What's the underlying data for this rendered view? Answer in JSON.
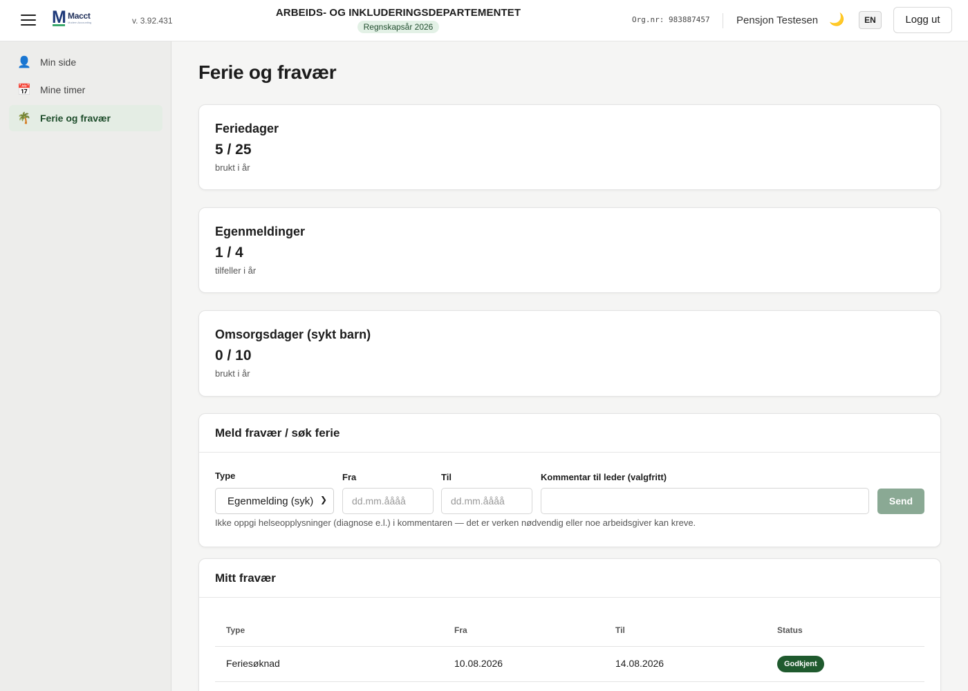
{
  "header": {
    "logo_name": "Macct",
    "logo_sub": "Modern Accounting",
    "version": "v. 3.92.431",
    "org_name": "ARBEIDS- OG INKLUDERINGSDEPARTEMENTET",
    "fiscal_year": "Regnskapsår 2026",
    "org_nr": "Org.nr: 983887457",
    "user_name": "Pensjon Testesen",
    "theme_icon": "moon-icon",
    "language_button": "EN",
    "logout_label": "Logg ut"
  },
  "sidebar": {
    "items": [
      {
        "label": "Min side",
        "icon": "user-icon",
        "active": false
      },
      {
        "label": "Mine timer",
        "icon": "calendar-icon",
        "active": false
      },
      {
        "label": "Ferie og fravær",
        "icon": "palm-tree-icon",
        "active": true
      }
    ]
  },
  "main": {
    "title": "Ferie og fravær",
    "stats": [
      {
        "title": "Feriedager",
        "value": "5 / 25",
        "sub": "brukt i år"
      },
      {
        "title": "Egenmeldinger",
        "value": "1 / 4",
        "sub": "tilfeller i år"
      },
      {
        "title": "Omsorgsdager (sykt barn)",
        "value": "0 / 10",
        "sub": "brukt i år"
      }
    ],
    "form": {
      "title": "Meld fravær / søk ferie",
      "type_label": "Type",
      "type_value": "Egenmelding (syk)",
      "from_label": "Fra",
      "from_placeholder": "dd.mm.åååå",
      "to_label": "Til",
      "to_placeholder": "dd.mm.åååå",
      "comment_label": "Kommentar til leder (valgfritt)",
      "comment_value": "",
      "send_label": "Send",
      "hint": "Ikke oppgi helseopplysninger (diagnose e.l.) i kommentaren — det er verken nødvendig eller noe arbeidsgiver kan kreve."
    },
    "absence": {
      "title": "Mitt fravær",
      "columns": [
        "Type",
        "Fra",
        "Til",
        "Status"
      ],
      "rows": [
        {
          "type": "Feriesøknad",
          "from": "10.08.2026",
          "to": "14.08.2026",
          "status": "Godkjent"
        }
      ]
    }
  },
  "colors": {
    "accent_green": "#1f5a2e",
    "fiscal_pill_bg": "#e3f1e6",
    "send_button_bg": "#8aa994",
    "sidebar_active_bg": "#e4ede4"
  }
}
